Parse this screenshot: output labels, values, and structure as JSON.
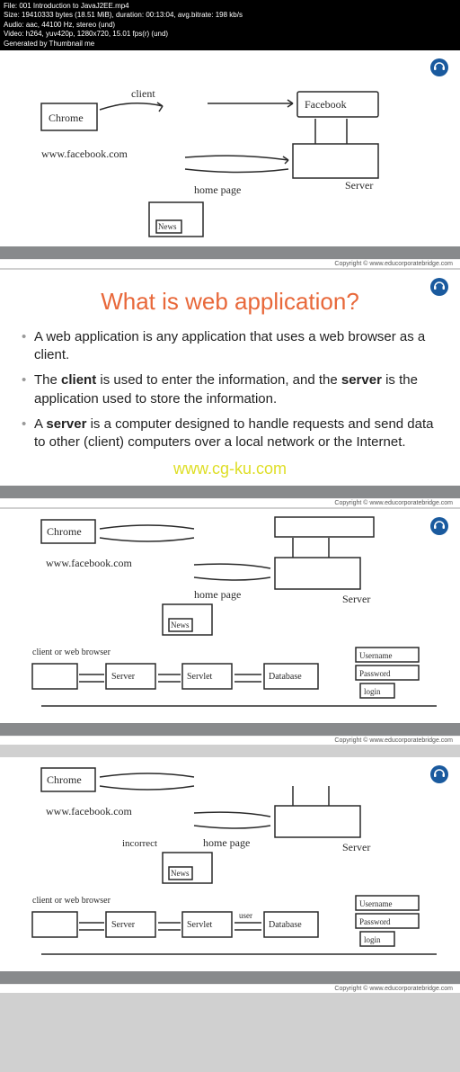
{
  "meta": {
    "file": "File: 001 Introduction to JavaJ2EE.mp4",
    "size": "Size: 19410333 bytes (18.51 MiB), duration: 00:13:04, avg.bitrate: 198 kb/s",
    "audio": "Audio: aac, 44100 Hz, stereo (und)",
    "video": "Video: h264, yuv420p, 1280x720, 15.01 fps(r) (und)",
    "gen": "Generated by Thumbnail me"
  },
  "copyright": "Copyright © www.educorporatebridge.com",
  "slide": {
    "title": "What is web application?",
    "bullets": {
      "b1": "A web application is any application that uses a web browser as a client.",
      "b2_pre": "The ",
      "b2_client": "client",
      "b2_mid": " is used to enter the information, and the ",
      "b2_server": "server",
      "b2_post": " is the application used to store the information.",
      "b3_pre": "A ",
      "b3_server": "server",
      "b3_post": " is a computer designed to handle requests and send data to other (client) computers over a local network or the Internet."
    }
  },
  "watermark": "www.cg-ku.com",
  "sketch": {
    "chrome": "Chrome",
    "client": "client",
    "facebook": "Facebook",
    "url": "www.facebook.com",
    "server": "Server",
    "homepage": "home page",
    "news": "News",
    "clientbrowser": "client or web browser",
    "servlet": "Servlet",
    "database": "Database",
    "username": "Username",
    "password": "Password",
    "login": "login",
    "incorrect": "incorrect",
    "user": "user"
  }
}
